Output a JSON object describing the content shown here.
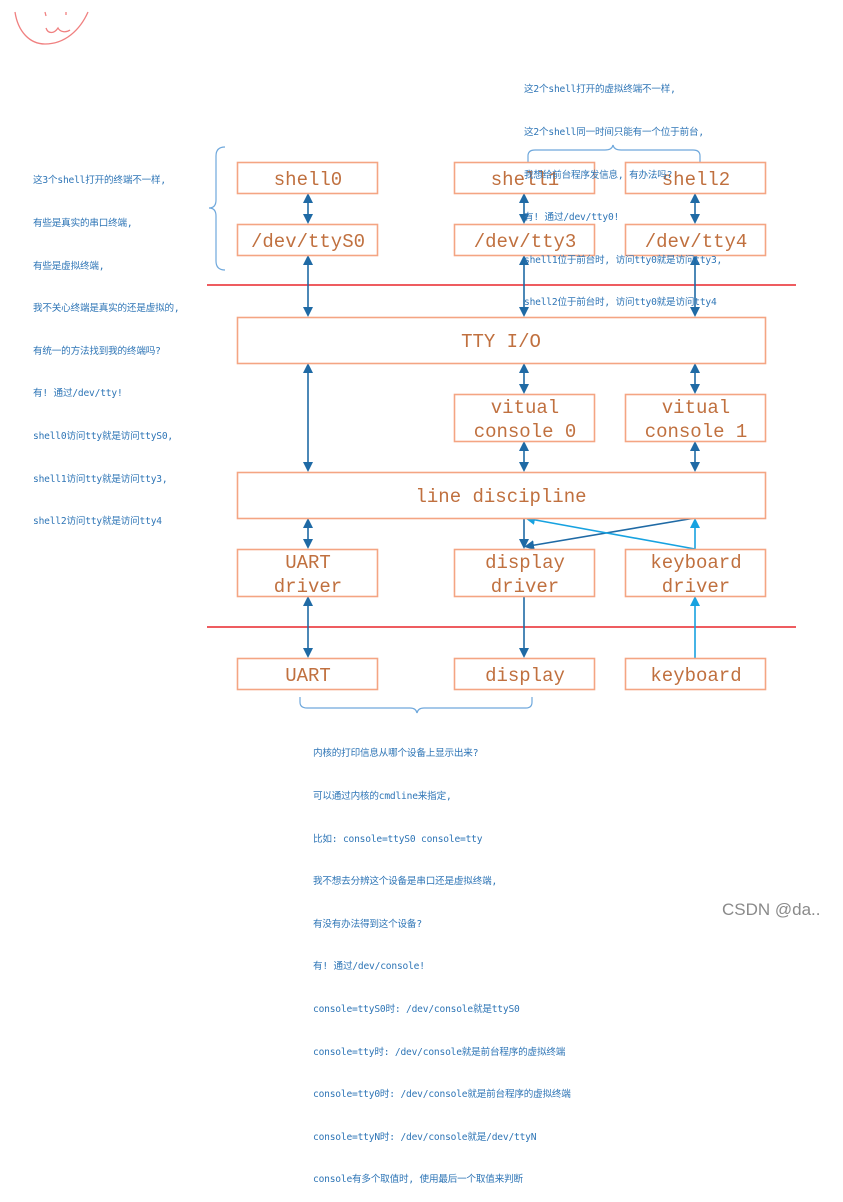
{
  "colors": {
    "box_border": "#f4a583",
    "box_text": "#c0703f",
    "arrow_dark": "#1f6aa5",
    "arrow_light": "#17a2e0",
    "divider": "#e8262b",
    "note_text": "#2e75b6",
    "brace": "#6fa8dc",
    "doodle": "#f08080"
  },
  "boxes": {
    "shell0": "shell0",
    "shell1": "shell1",
    "shell2": "shell2",
    "ttyS0": "/dev/ttyS0",
    "tty3": "/dev/tty3",
    "tty4": "/dev/tty4",
    "tty_io": "TTY I/O",
    "vc0": [
      "vitual",
      "console 0"
    ],
    "vc1": [
      "vitual",
      "console 1"
    ],
    "line_discipline": "line discipline",
    "uart_driver": [
      "UART",
      "driver"
    ],
    "display_driver": [
      "display",
      "driver"
    ],
    "keyboard_driver": [
      "keyboard",
      "driver"
    ],
    "uart": "UART",
    "display": "display",
    "keyboard": "keyboard"
  },
  "notes": {
    "left": [
      "这3个shell打开的终端不一样,",
      "有些是真实的串口终端,",
      "有些是虚拟终端,",
      "我不关心终端是真实的还是虚拟的,",
      "有统一的方法找到我的终端吗?",
      "有! 通过/dev/tty!",
      "shell0访问tty就是访问ttyS0,",
      "shell1访问tty就是访问tty3,",
      "shell2访问tty就是访问tty4"
    ],
    "top_right": [
      "这2个shell打开的虚拟终端不一样,",
      "这2个shell同一时间只能有一个位于前台,",
      "我想给前台程序发信息, 有办法吗?",
      "有! 通过/dev/tty0!",
      "shell1位于前台时, 访问tty0就是访问tty3,",
      "shell2位于前台时, 访问tty0就是访问tty4"
    ],
    "bottom": [
      "内核的打印信息从哪个设备上显示出来?",
      "可以通过内核的cmdline来指定,",
      "比如: console=ttyS0 console=tty",
      "我不想去分辨这个设备是串口还是虚拟终端,",
      "有没有办法得到这个设备?",
      "有! 通过/dev/console!",
      "console=ttyS0时: /dev/console就是ttyS0",
      "console=tty时: /dev/console就是前台程序的虚拟终端",
      "console=tty0时: /dev/console就是前台程序的虚拟终端",
      "console=ttyN时: /dev/console就是/dev/ttyN",
      "console有多个取值时, 使用最后一个取值来判断"
    ]
  },
  "watermark": "CSDN @da.."
}
